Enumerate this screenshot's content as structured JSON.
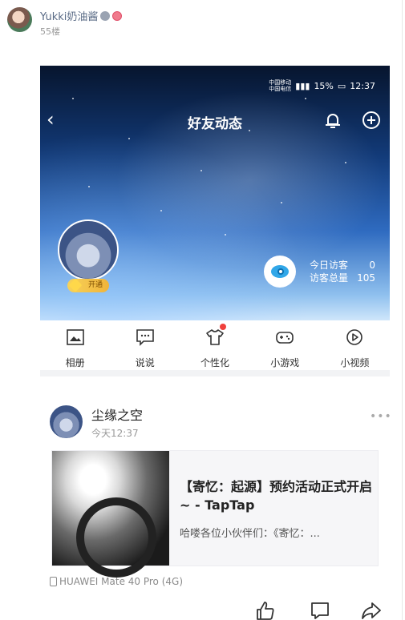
{
  "post": {
    "username": "Yukki奶油酱",
    "floor": "55楼"
  },
  "screenshot": {
    "status": {
      "carrier1": "中国移动",
      "carrier2": "中国电信",
      "battery": "15%",
      "time": "12:37"
    },
    "title": "好友动态",
    "vip_label": "开通",
    "visits": {
      "today_label": "今日访客",
      "today_value": "0",
      "total_label": "访客总量",
      "total_value": "105"
    },
    "icons": [
      {
        "label": "相册",
        "icon": "photo-album-icon"
      },
      {
        "label": "说说",
        "icon": "chat-bubble-icon"
      },
      {
        "label": "个性化",
        "icon": "tshirt-icon",
        "red_dot": true
      },
      {
        "label": "小游戏",
        "icon": "gamepad-icon"
      },
      {
        "label": "小视频",
        "icon": "play-circle-icon"
      }
    ]
  },
  "feed": {
    "name": "尘缘之空",
    "time": "今天12:37",
    "more": "•••",
    "link_title": "【寄忆：起源】预约活动正式开启~ - TapTap",
    "link_desc": "哈喽各位小伙伴们：《寄忆：...",
    "device": "HUAWEI Mate 40 Pro (4G)"
  },
  "colors": {
    "username": "#5a6b86",
    "accent_red": "#f0403c",
    "vip_gold": "#f0b43a"
  }
}
